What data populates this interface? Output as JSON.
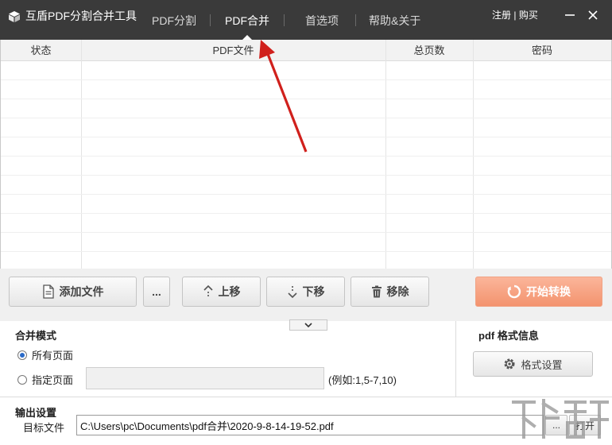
{
  "app": {
    "title": "互盾PDF分割合并工具"
  },
  "tabs": [
    {
      "label": "PDF分割",
      "active": false
    },
    {
      "label": "PDF合并",
      "active": true
    },
    {
      "label": "首选项",
      "active": false
    },
    {
      "label": "帮助&关于",
      "active": false
    }
  ],
  "account": {
    "register": "注册",
    "separator": " | ",
    "buy": "购买"
  },
  "table": {
    "columns": [
      "状态",
      "PDF文件",
      "总页数",
      "密码"
    ],
    "rows": []
  },
  "toolbar": {
    "add_file": "添加文件",
    "more": "...",
    "move_up": "上移",
    "move_down": "下移",
    "remove": "移除",
    "start": "开始转换"
  },
  "merge_mode": {
    "title": "合并模式",
    "all_pages": "所有页面",
    "specified_pages": "指定页面",
    "selected": "all_pages",
    "range_value": "",
    "range_hint": "(例如:1,5-7,10)"
  },
  "pdf_format": {
    "title": "pdf 格式信息",
    "settings_button": "格式设置"
  },
  "output": {
    "title": "输出设置",
    "target_label": "目标文件",
    "target_value": "C:\\Users\\pc\\Documents\\pdf合并\\2020-9-8-14-19-52.pdf",
    "browse": "...",
    "open": "打开"
  },
  "colors": {
    "titlebar": "#3a3a3a",
    "accent": "#f3936e",
    "arrow": "#d0201c"
  }
}
